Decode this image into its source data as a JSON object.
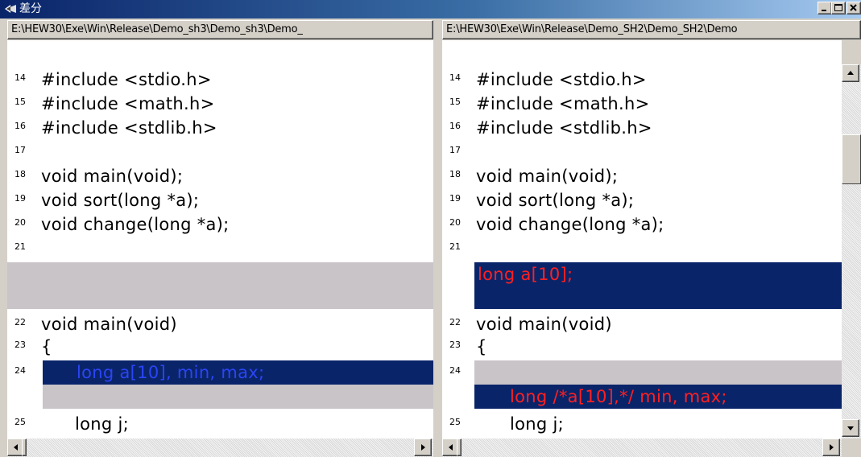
{
  "window": {
    "title": "差分"
  },
  "left_pane": {
    "path": "E:\\HEW30\\Exe\\Win\\Release\\Demo_sh3\\Demo_sh3\\Demo_",
    "lines": [
      {
        "ln": "14",
        "code": "#include <stdio.h>"
      },
      {
        "ln": "15",
        "code": "#include <math.h>"
      },
      {
        "ln": "16",
        "code": "#include <stdlib.h>"
      },
      {
        "ln": "17",
        "code": ""
      },
      {
        "ln": "18",
        "code": "void main(void);"
      },
      {
        "ln": "19",
        "code": "void sort(long *a);"
      },
      {
        "ln": "20",
        "code": "void change(long *a);"
      },
      {
        "ln": "21",
        "code": ""
      },
      {
        "ln": "22",
        "code": "void main(void)"
      },
      {
        "ln": "23",
        "code": "{"
      },
      {
        "ln": "24",
        "code": "long a[10], min, max;"
      },
      {
        "ln": "25",
        "code": "long j;"
      }
    ]
  },
  "right_pane": {
    "path": "E:\\HEW30\\Exe\\Win\\Release\\Demo_SH2\\Demo_SH2\\Demo",
    "lines": [
      {
        "ln": "14",
        "code": "#include <stdio.h>"
      },
      {
        "ln": "15",
        "code": "#include <math.h>"
      },
      {
        "ln": "16",
        "code": "#include <stdlib.h>"
      },
      {
        "ln": "17",
        "code": ""
      },
      {
        "ln": "18",
        "code": "void main(void);"
      },
      {
        "ln": "19",
        "code": "void sort(long *a);"
      },
      {
        "ln": "20",
        "code": "void change(long *a);"
      },
      {
        "ln": "21",
        "code": ""
      },
      {
        "ln": "",
        "code": "long a[10];"
      },
      {
        "ln": "22",
        "code": "void main(void)"
      },
      {
        "ln": "23",
        "code": "{"
      },
      {
        "ln": "24",
        "code": ""
      },
      {
        "ln": "",
        "code": "long /*a[10],*/ min, max;"
      },
      {
        "ln": "25",
        "code": "long j;"
      }
    ]
  },
  "colors": {
    "added_text": "#ff2020",
    "changed_text": "#2b45f5",
    "selection_bg": "#0a246a",
    "gap_bg": "#c8c4c8"
  }
}
